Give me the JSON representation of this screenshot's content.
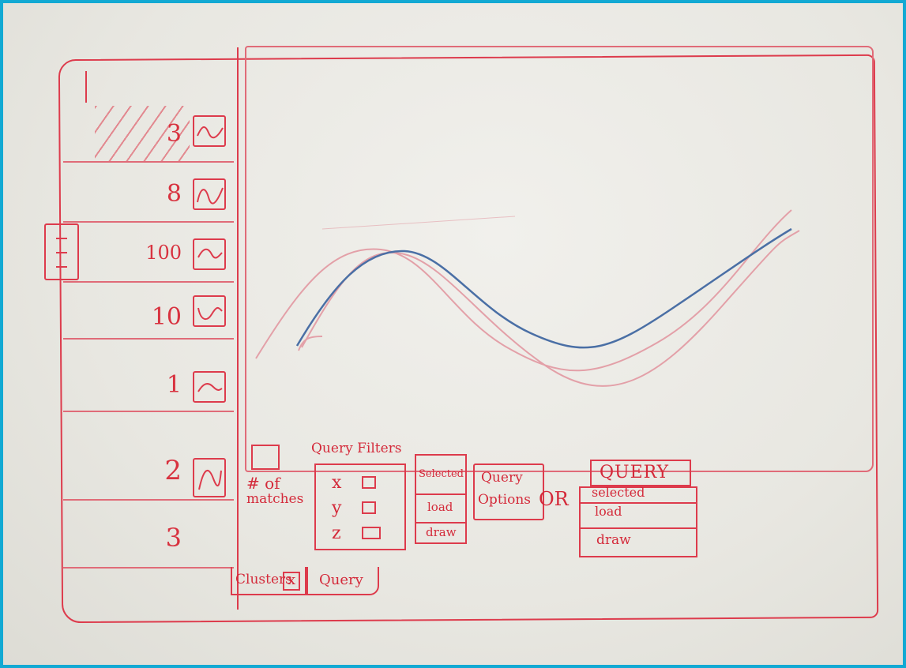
{
  "clusters": [
    {
      "count": "3",
      "selected": true
    },
    {
      "count": "8",
      "selected": false
    },
    {
      "count": "100",
      "selected": false
    },
    {
      "count": "10",
      "selected": false
    },
    {
      "count": "1",
      "selected": false
    },
    {
      "count": "2",
      "selected": false
    },
    {
      "count": "3",
      "selected": false
    }
  ],
  "query_panel": {
    "matches_label_line1": "# of",
    "matches_label_line2": "matches",
    "filters_title": "Query Filters",
    "filters": [
      {
        "label": "x"
      },
      {
        "label": "y"
      },
      {
        "label": "z"
      }
    ]
  },
  "actions_small": {
    "selected": "Selected",
    "load": "load",
    "draw": "draw"
  },
  "query_options": {
    "line1": "Query",
    "line2": "Options"
  },
  "or_label": "OR",
  "actions_large": {
    "query": "QUERY",
    "selected": "selected",
    "load": "load",
    "draw": "draw"
  },
  "tabs": {
    "clusters": "Clusters",
    "close": "x",
    "query": "Query"
  },
  "colors": {
    "marker": "#dd3b4c",
    "highlight_series": "#4a6fa5",
    "faint_series": "#e3a0a8",
    "frame": "#12a9d3"
  },
  "icons": {
    "sidebar_toggle": "hamburger-icon",
    "thumbnail": "mini-line-chart-icon"
  }
}
